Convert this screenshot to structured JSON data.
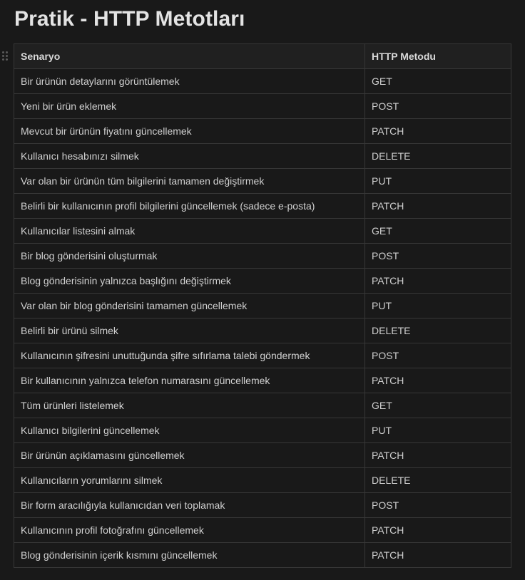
{
  "page": {
    "title": "Pratik - HTTP Metotları"
  },
  "table": {
    "headers": [
      "Senaryo",
      "HTTP Metodu"
    ],
    "rows": [
      [
        "Bir ürünün detaylarını görüntülemek",
        "GET"
      ],
      [
        "Yeni bir ürün eklemek",
        "POST"
      ],
      [
        "Mevcut bir ürünün fiyatını güncellemek",
        "PATCH"
      ],
      [
        "Kullanıcı hesabınızı silmek",
        "DELETE"
      ],
      [
        "Var olan bir ürünün tüm bilgilerini tamamen değiştirmek",
        "PUT"
      ],
      [
        "Belirli bir kullanıcının profil bilgilerini güncellemek (sadece e-posta)",
        "PATCH"
      ],
      [
        "Kullanıcılar listesini almak",
        "GET"
      ],
      [
        "Bir blog gönderisini oluşturmak",
        "POST"
      ],
      [
        "Blog gönderisinin yalnızca başlığını değiştirmek",
        "PATCH"
      ],
      [
        "Var olan bir blog gönderisini tamamen güncellemek",
        "PUT"
      ],
      [
        "Belirli bir ürünü silmek",
        "DELETE"
      ],
      [
        "Kullanıcının şifresini unuttuğunda şifre sıfırlama talebi göndermek",
        "POST"
      ],
      [
        "Bir kullanıcının yalnızca telefon numarasını güncellemek",
        "PATCH"
      ],
      [
        "Tüm ürünleri listelemek",
        "GET"
      ],
      [
        "Kullanıcı bilgilerini güncellemek",
        "PUT"
      ],
      [
        "Bir ürünün açıklamasını güncellemek",
        "PATCH"
      ],
      [
        "Kullanıcıların yorumlarını silmek",
        "DELETE"
      ],
      [
        "Bir form aracılığıyla kullanıcıdan veri toplamak",
        "POST"
      ],
      [
        "Kullanıcının profil fotoğrafını güncellemek",
        "PATCH"
      ],
      [
        "Blog gönderisinin içerik kısmını güncellemek",
        "PATCH"
      ]
    ]
  },
  "icons": {
    "drag_handle": "drag-handle-icon"
  },
  "colors": {
    "background": "#191919",
    "header_background": "#202020",
    "border": "#373737",
    "text": "#d0d0d0",
    "title": "#e3e3e3"
  }
}
